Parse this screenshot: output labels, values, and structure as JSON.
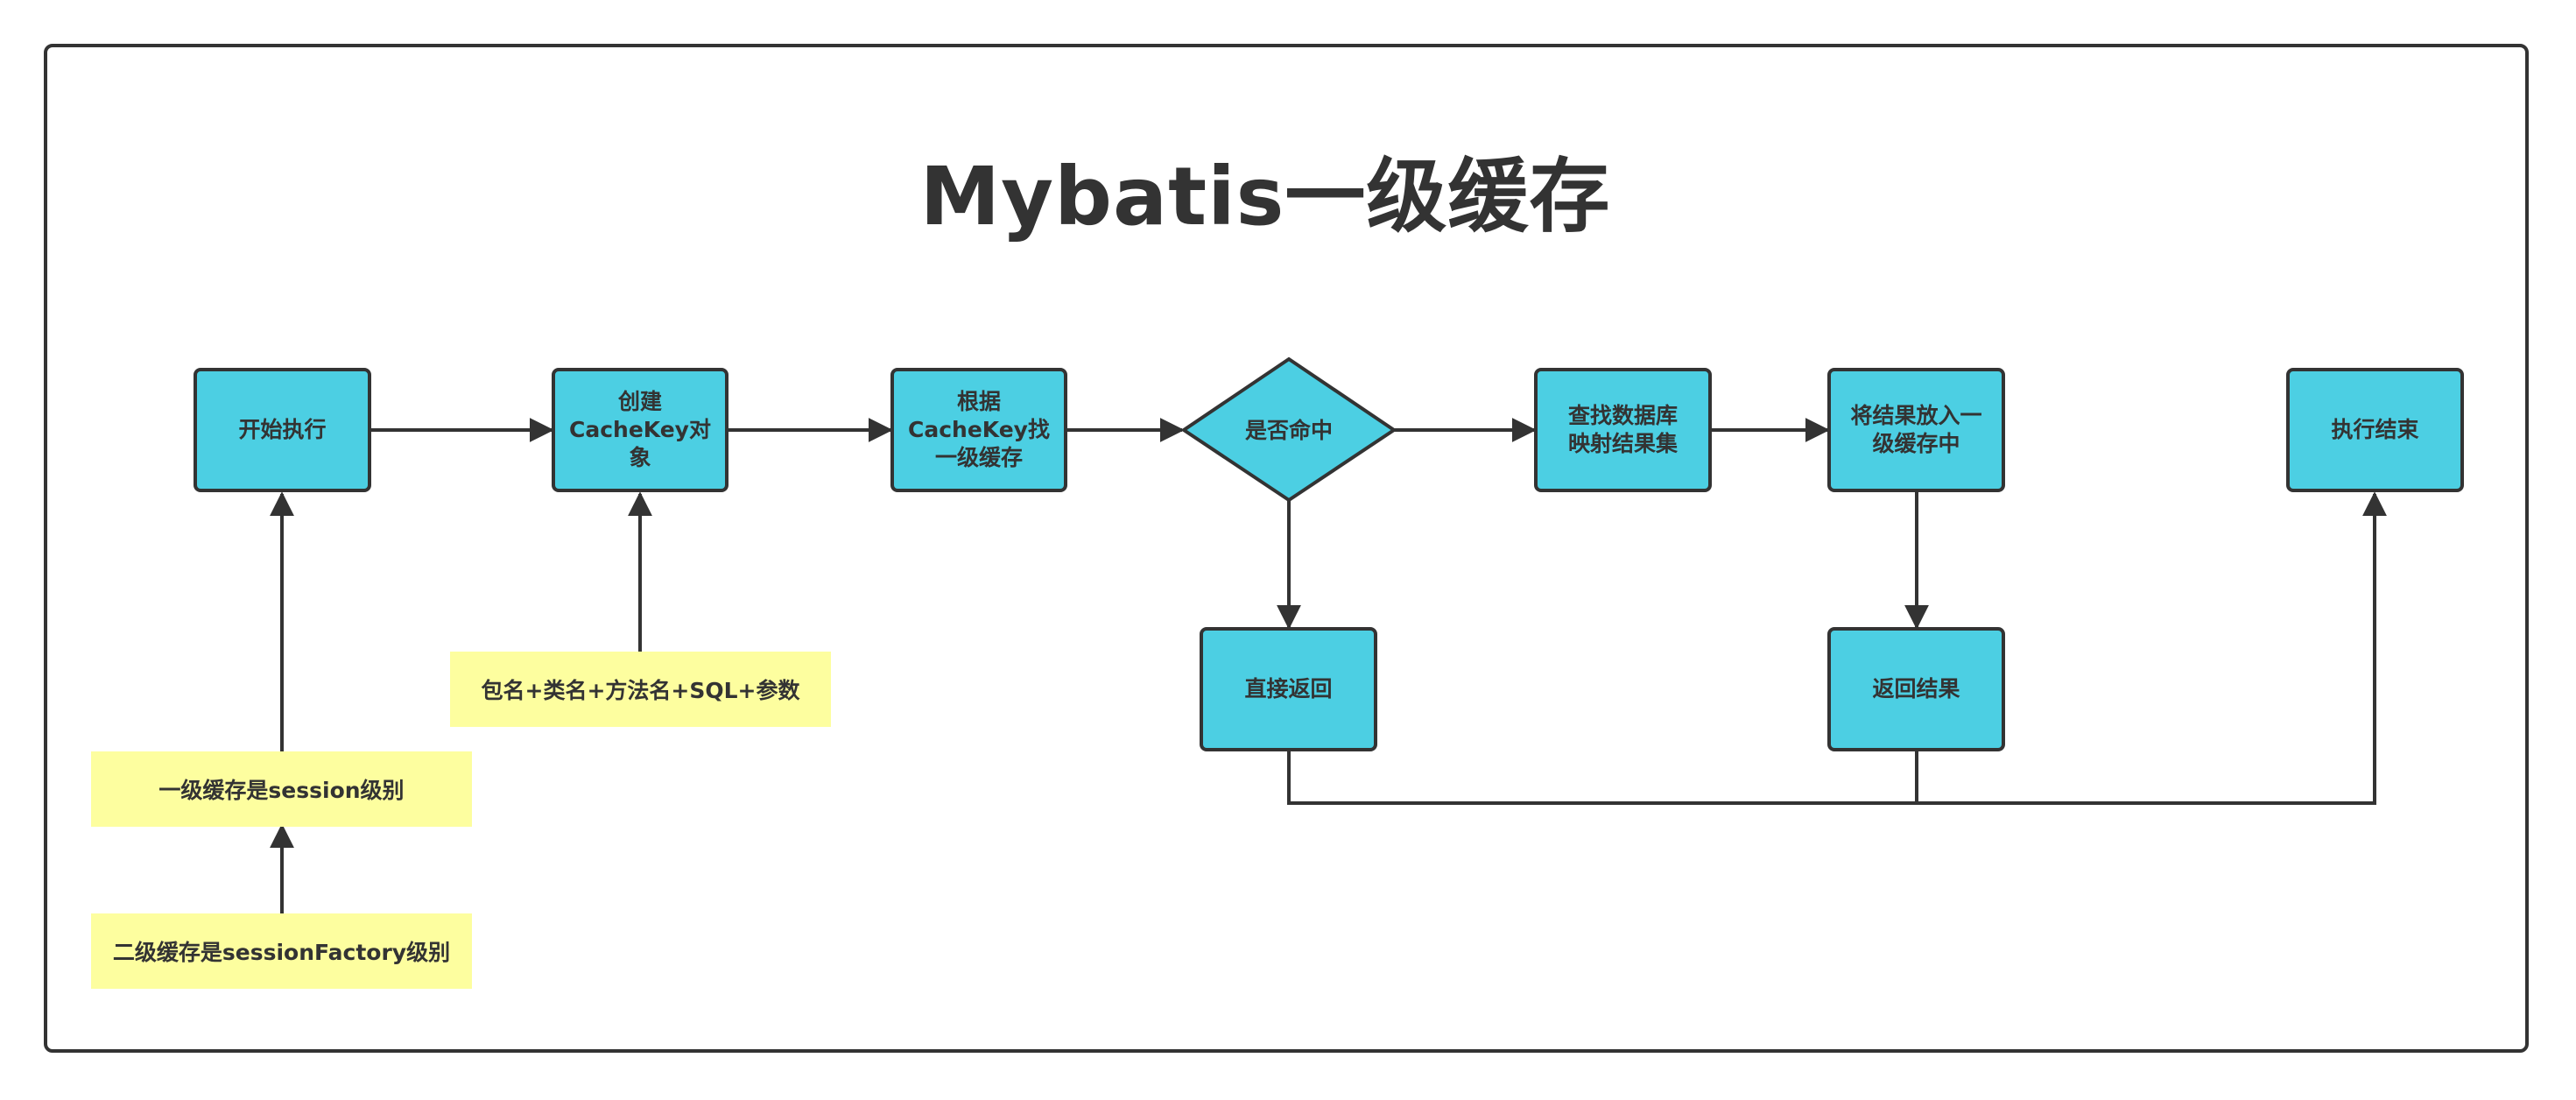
{
  "title": "Mybatis一级缓存",
  "nodes": {
    "start": "开始执行",
    "create_key": "创建\nCacheKey对\n象",
    "find_cache": "根据\nCacheKey找\n一级缓存",
    "hit": "是否命中",
    "query_db": "查找数据库\n映射结果集",
    "put_cache": "将结果放入一\n级缓存中",
    "end": "执行结束",
    "direct_return": "直接返回",
    "return_result": "返回结果"
  },
  "notes": {
    "key_parts": "包名+类名+方法名+SQL+参数",
    "level1": "一级缓存是session级别",
    "level2": "二级缓存是sessionFactory级别"
  },
  "colors": {
    "node_fill": "#4ccfe3",
    "note_fill": "#fdfe9f",
    "stroke": "#333333"
  }
}
